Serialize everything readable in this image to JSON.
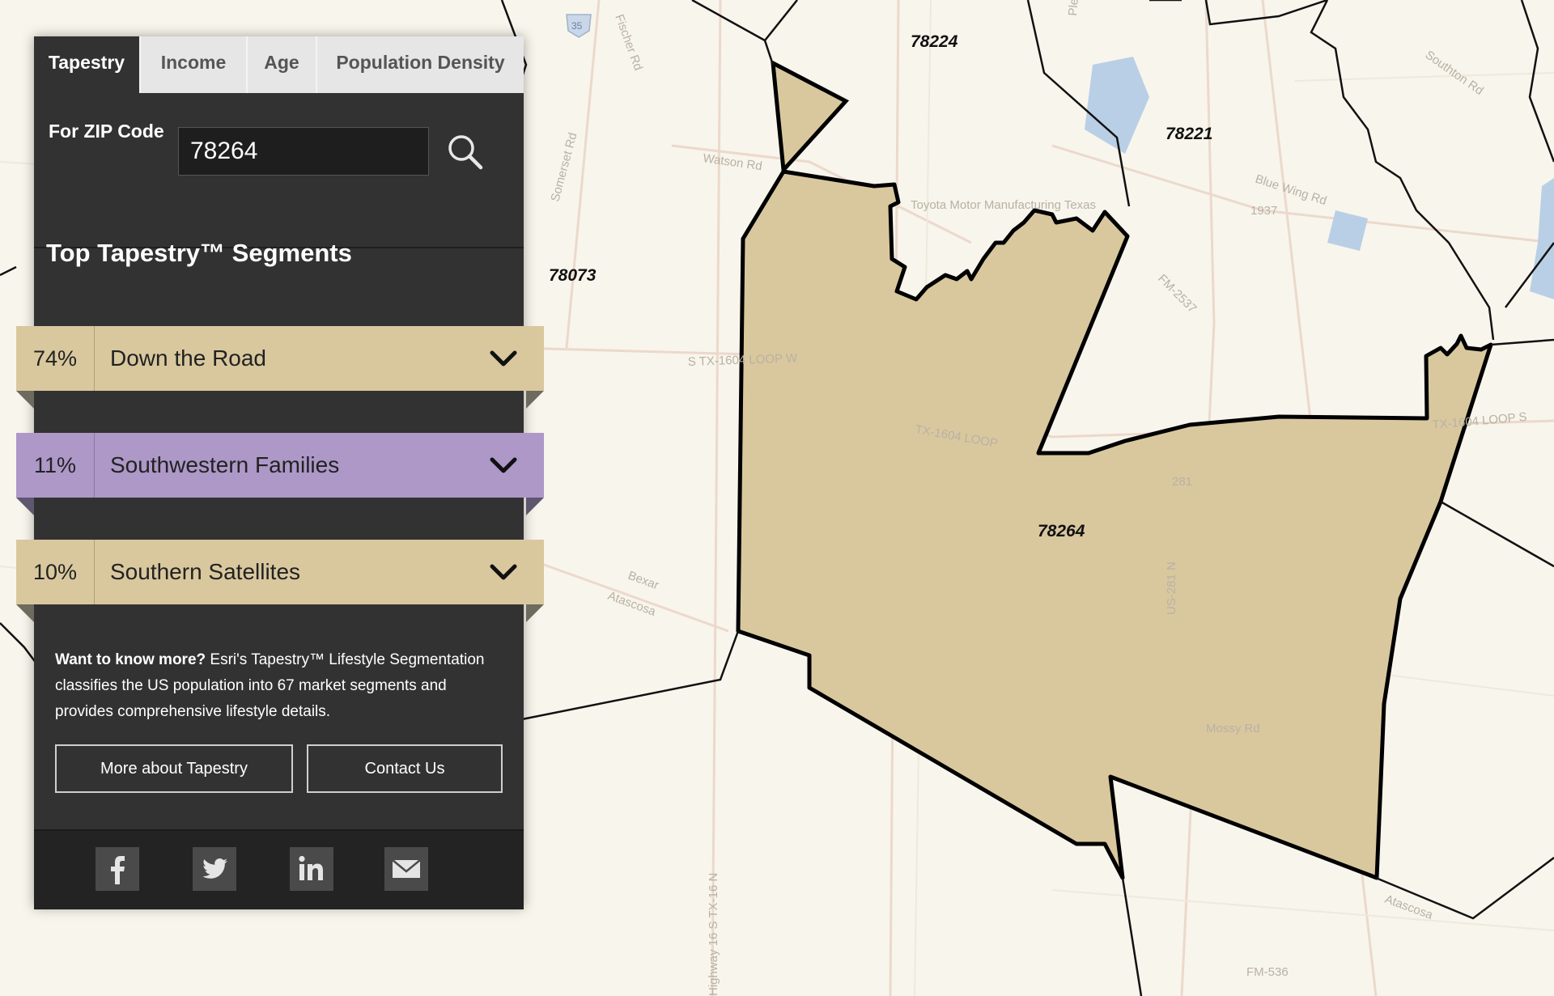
{
  "map": {
    "zip_labels": {
      "z78224": "78224",
      "z78221": "78221",
      "z78073": "78073",
      "z78264": "78264"
    },
    "road_labels": {
      "watson": "Watson Rd",
      "somerset": "Somerset Rd",
      "fischer": "Fischer Rd",
      "pleasanton": "Pleasanton Rd",
      "bluewing": "Blue Wing Rd",
      "southton": "Southton Rd",
      "loop1604w": "S TX-1604 LOOP W",
      "loop1604": "TX-1604 LOOP",
      "loop1604e": "TX-1604 LOOP S",
      "fm1937": "1937",
      "fm2537": "FM-2537",
      "bexar": "Bexar",
      "atascosa": "Atascosa",
      "atascosa2": "Atascosa",
      "fm536": "FM-536",
      "us281": "281",
      "toyota": "Toyota Motor Manufacturing Texas",
      "hwy16": "Highway 16 S TX-16 N",
      "us281n": "US-281 N",
      "mossy": "Mossy Rd",
      "i35": "35"
    },
    "colors": {
      "zip_fill": "#d9c89e",
      "zip_border": "#000000",
      "background": "#f8f5ec"
    }
  },
  "panel": {
    "tabs": [
      {
        "label": "Tapestry",
        "active": true
      },
      {
        "label": "Income",
        "active": false
      },
      {
        "label": "Age",
        "active": false
      },
      {
        "label": "Population Density",
        "active": false
      }
    ],
    "zip_label": "For ZIP Code",
    "zip_value": "78264",
    "segments_title": "Top Tapestry™ Segments",
    "segments": [
      {
        "pct": "74%",
        "name": "Down the Road",
        "color": "#d9c89e"
      },
      {
        "pct": "11%",
        "name": "Southwestern Families",
        "color": "#ad98c8"
      },
      {
        "pct": "10%",
        "name": "Southern Satellites",
        "color": "#d9c89e"
      }
    ],
    "info_bold": "Want to know more?",
    "info_text": " Esri's Tapestry™ Lifestyle Segmentation classifies the US population into 67 market segments and provides comprehensive lifestyle details.",
    "buttons": {
      "more": "More about Tapestry",
      "contact": "Contact Us"
    },
    "social_icons": [
      "facebook-icon",
      "twitter-icon",
      "linkedin-icon",
      "email-icon"
    ]
  }
}
